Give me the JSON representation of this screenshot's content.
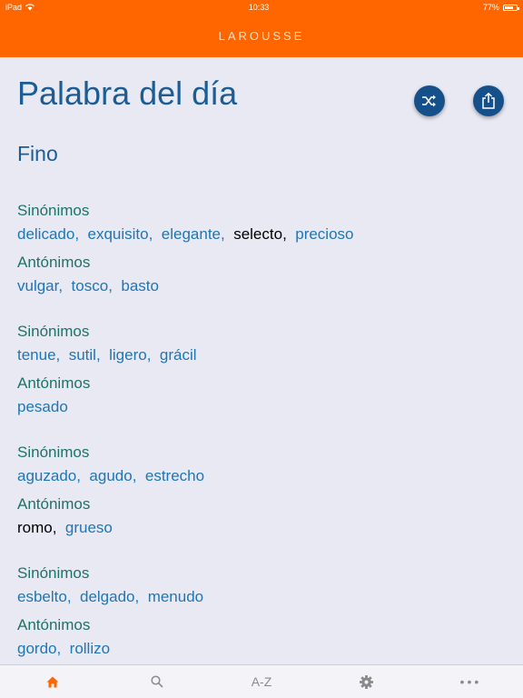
{
  "status_bar": {
    "device": "iPad",
    "time": "10:33",
    "battery": "77%",
    "battery_level": 0.77
  },
  "navbar": {
    "brand": "LAROUSSE"
  },
  "page": {
    "title": "Palabra del día",
    "word": "Fino"
  },
  "groups": [
    {
      "synonyms_label": "Sinónimos",
      "synonyms": [
        "delicado",
        "exquisito",
        "elegante",
        "selecto",
        "precioso"
      ],
      "antonyms_label": "Antónimos",
      "antonyms": [
        "vulgar",
        "tosco",
        "basto"
      ]
    },
    {
      "synonyms_label": "Sinónimos",
      "synonyms": [
        "tenue",
        "sutil",
        "ligero",
        "grácil"
      ],
      "antonyms_label": "Antónimos",
      "antonyms": [
        "pesado"
      ]
    },
    {
      "synonyms_label": "Sinónimos",
      "synonyms": [
        "aguzado",
        "agudo",
        "estrecho"
      ],
      "antonyms_label": "Antónimos",
      "antonyms": [
        "romo",
        "grueso"
      ]
    },
    {
      "synonyms_label": "Sinónimos",
      "synonyms": [
        "esbelto",
        "delgado",
        "menudo"
      ],
      "antonyms_label": "Antónimos",
      "antonyms": [
        "gordo",
        "rollizo"
      ]
    }
  ],
  "tabbar": {
    "home_icon": "home-icon",
    "search_icon": "search-icon",
    "az_label": "A-Z",
    "settings_icon": "gear-icon",
    "more_label": "•••"
  },
  "colors": {
    "accent": "#ff6600",
    "title": "#1b5d94",
    "label": "#1e7268",
    "link": "#1e76b4"
  }
}
